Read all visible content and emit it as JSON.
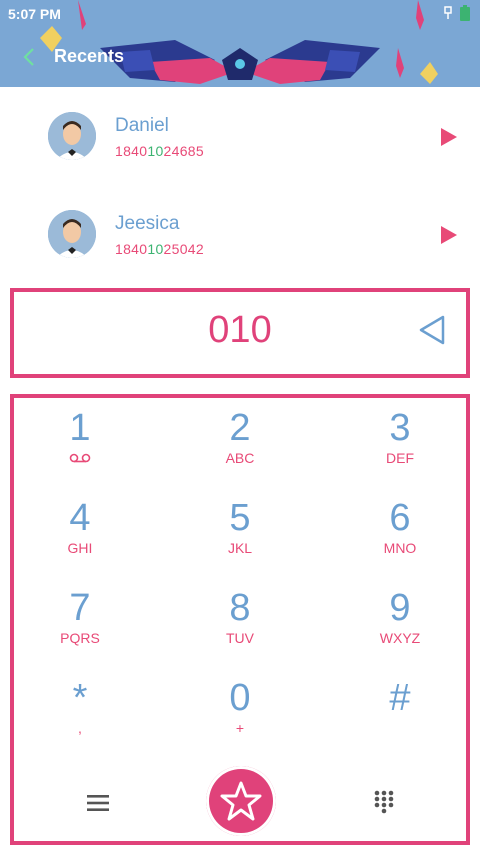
{
  "status_bar": {
    "time": "5:07 PM"
  },
  "header": {
    "title": "Recents"
  },
  "recents": [
    {
      "name": "Daniel",
      "number_prefix": "1840",
      "number_mid": "10",
      "number_suffix": "24685"
    },
    {
      "name": "Jeesica",
      "number_prefix": "1840",
      "number_mid": "10",
      "number_suffix": "25042"
    }
  ],
  "display": {
    "number": "010"
  },
  "keypad": [
    {
      "digit": "1",
      "letters": "voicemail-icon"
    },
    {
      "digit": "2",
      "letters": "ABC"
    },
    {
      "digit": "3",
      "letters": "DEF"
    },
    {
      "digit": "4",
      "letters": "GHI"
    },
    {
      "digit": "5",
      "letters": "JKL"
    },
    {
      "digit": "6",
      "letters": "MNO"
    },
    {
      "digit": "7",
      "letters": "PQRS"
    },
    {
      "digit": "8",
      "letters": "TUV"
    },
    {
      "digit": "9",
      "letters": "WXYZ"
    },
    {
      "digit": "*",
      "letters": ","
    },
    {
      "digit": "0",
      "letters": "+"
    },
    {
      "digit": "#",
      "letters": ""
    }
  ],
  "colors": {
    "accent": "#e0427a",
    "blue": "#6b9fd0",
    "header_bg": "#7ba7d4",
    "highlight": "#3cb371"
  },
  "icons": [
    "back-arrow-icon",
    "play-icon",
    "backspace-icon",
    "menu-icon",
    "star-icon",
    "dialpad-grid-icon"
  ]
}
